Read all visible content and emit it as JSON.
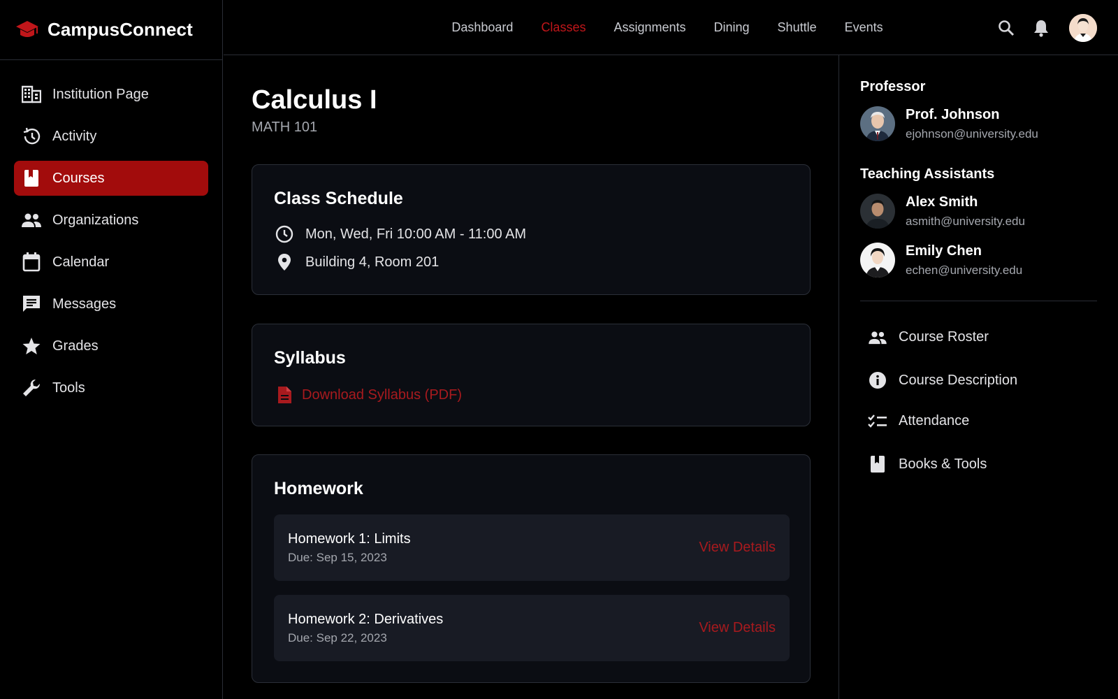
{
  "brand": {
    "name": "CampusConnect",
    "logo_icon": "graduation-cap-icon"
  },
  "colors": {
    "accent": "#a20c0c",
    "accent_text": "#c0161a",
    "link": "#a81a1e",
    "bg": "#000000",
    "card": "#0b0d13"
  },
  "sidebar": {
    "items": [
      {
        "label": "Institution Page",
        "icon": "building-icon"
      },
      {
        "label": "Activity",
        "icon": "history-icon"
      },
      {
        "label": "Courses",
        "icon": "book-icon",
        "active": true
      },
      {
        "label": "Organizations",
        "icon": "group-icon"
      },
      {
        "label": "Calendar",
        "icon": "calendar-icon"
      },
      {
        "label": "Messages",
        "icon": "message-icon"
      },
      {
        "label": "Grades",
        "icon": "star-icon"
      },
      {
        "label": "Tools",
        "icon": "wrench-icon"
      }
    ]
  },
  "topnav": {
    "items": [
      {
        "label": "Dashboard"
      },
      {
        "label": "Classes",
        "active": true
      },
      {
        "label": "Assignments"
      },
      {
        "label": "Dining"
      },
      {
        "label": "Shuttle"
      },
      {
        "label": "Events"
      }
    ]
  },
  "course": {
    "title": "Calculus I",
    "code": "MATH 101"
  },
  "schedule": {
    "title": "Class Schedule",
    "time": "Mon, Wed, Fri 10:00 AM - 11:00 AM",
    "location": "Building 4, Room 201"
  },
  "syllabus": {
    "title": "Syllabus",
    "download_label": "Download Syllabus (PDF)"
  },
  "homework": {
    "title": "Homework",
    "items": [
      {
        "title": "Homework 1: Limits",
        "due": "Due: Sep 15, 2023",
        "action": "View Details"
      },
      {
        "title": "Homework 2: Derivatives",
        "due": "Due: Sep 22, 2023",
        "action": "View Details"
      }
    ]
  },
  "right": {
    "professor_title": "Professor",
    "professor": {
      "name": "Prof. Johnson",
      "email": "ejohnson@university.edu"
    },
    "ta_title": "Teaching Assistants",
    "tas": [
      {
        "name": "Alex Smith",
        "email": "asmith@university.edu"
      },
      {
        "name": "Emily Chen",
        "email": "echen@university.edu"
      }
    ],
    "links": [
      {
        "label": "Course Roster",
        "icon": "group-icon"
      },
      {
        "label": "Course Description",
        "icon": "info-icon"
      },
      {
        "label": "Attendance",
        "icon": "checklist-icon"
      },
      {
        "label": "Books & Tools",
        "icon": "book-icon"
      }
    ]
  }
}
